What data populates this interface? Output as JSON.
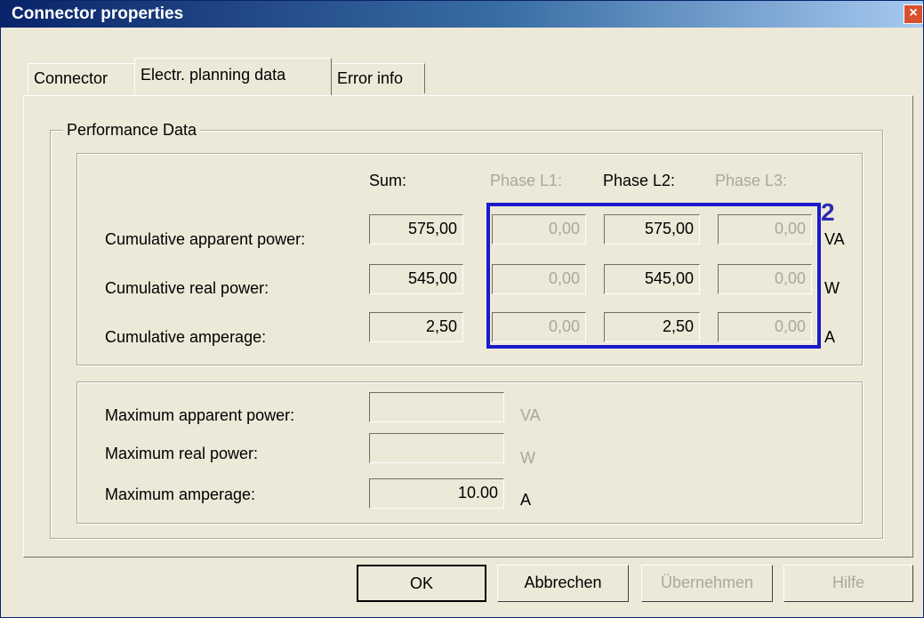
{
  "window": {
    "title": "Connector properties",
    "close_symbol": "×"
  },
  "tabs": [
    {
      "label": "Connector",
      "active": false
    },
    {
      "label": "Electr. planning data",
      "active": true
    },
    {
      "label": "Error info",
      "active": false
    }
  ],
  "performance": {
    "group_title": "Performance Data",
    "columns": {
      "sum": "Sum:",
      "l1": "Phase L1:",
      "l2": "Phase L2:",
      "l3": "Phase L3:"
    },
    "rows": [
      {
        "label": "Cumulative apparent power:",
        "sum": "575,00",
        "l1": "0,00",
        "l2": "575,00",
        "l3": "0,00",
        "unit": "VA"
      },
      {
        "label": "Cumulative real power:",
        "sum": "545,00",
        "l1": "0,00",
        "l2": "545,00",
        "l3": "0,00",
        "unit": "W"
      },
      {
        "label": "Cumulative amperage:",
        "sum": "2,50",
        "l1": "0,00",
        "l2": "2,50",
        "l3": "0,00",
        "unit": "A"
      }
    ]
  },
  "maximums": [
    {
      "label": "Maximum apparent power:",
      "value": "",
      "unit": "VA"
    },
    {
      "label": "Maximum real power:",
      "value": "",
      "unit": "W"
    },
    {
      "label": "Maximum amperage:",
      "value": "10.00",
      "unit": "A"
    }
  ],
  "annotation": {
    "marker": "2",
    "color": "#1a1acc"
  },
  "buttons": {
    "ok": "OK",
    "cancel": "Abbrechen",
    "apply": "Übernehmen",
    "help": "Hilfe"
  }
}
